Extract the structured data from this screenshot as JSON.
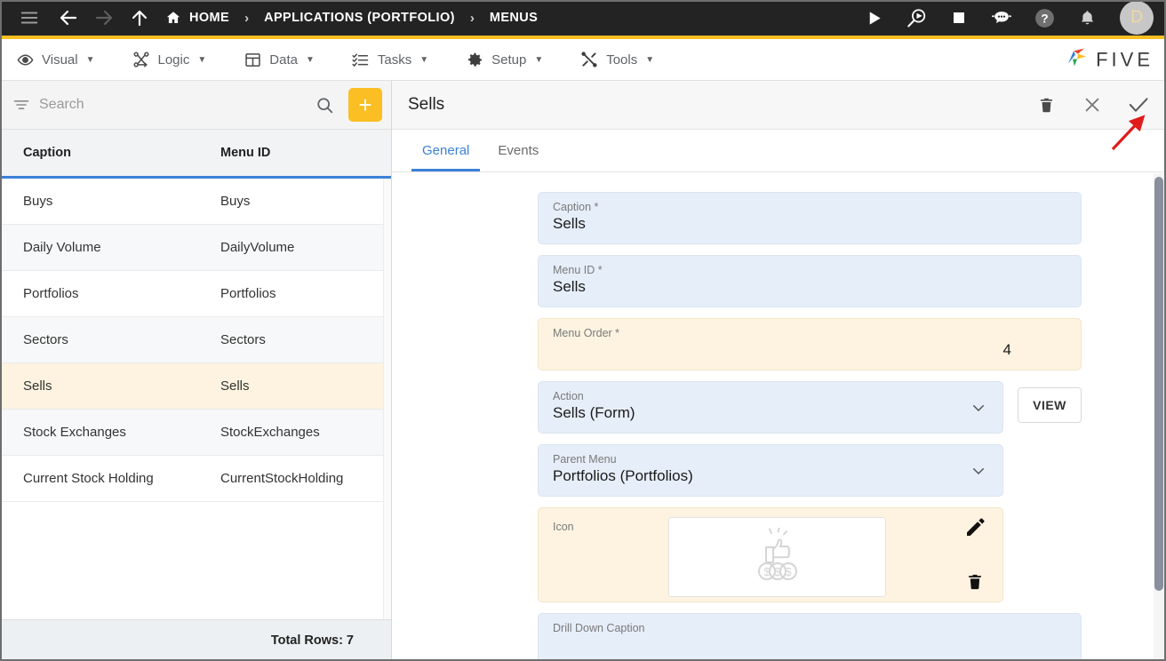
{
  "topbar": {
    "icons": [
      {
        "name": "hamburger-menu-icon",
        "label": "Menu"
      },
      {
        "name": "back-arrow-icon",
        "label": "Back"
      },
      {
        "name": "forward-arrow-icon",
        "label": "Forward"
      },
      {
        "name": "up-arrow-icon",
        "label": "Up"
      }
    ],
    "breadcrumbs": [
      {
        "label": "HOME",
        "icon": "home-icon"
      },
      {
        "label": "APPLICATIONS (PORTFOLIO)",
        "icon": ""
      },
      {
        "label": "MENUS",
        "icon": ""
      }
    ],
    "separator": "›",
    "right_icons": [
      {
        "name": "run-play-icon",
        "label": "Run"
      },
      {
        "name": "debug-magnifier-play-icon",
        "label": "Debug"
      },
      {
        "name": "stop-square-icon",
        "label": "Stop"
      },
      {
        "name": "assistant-robot-icon",
        "label": "Assistant"
      },
      {
        "name": "help-question-icon",
        "label": "Help"
      },
      {
        "name": "notification-bell-icon",
        "label": "Notifications"
      }
    ],
    "avatar_initial": "D",
    "accent_bar_color": "#fbbf24",
    "background_color": "#232323"
  },
  "menubar": {
    "items": [
      {
        "label": "Visual",
        "icon": "eye-icon",
        "caret": "▼"
      },
      {
        "label": "Logic",
        "icon": "logic-nodes-icon",
        "caret": "▼"
      },
      {
        "label": "Data",
        "icon": "data-grid-icon",
        "caret": "▼"
      },
      {
        "label": "Tasks",
        "icon": "tasks-checklist-icon",
        "caret": "▼"
      },
      {
        "label": "Setup",
        "icon": "gear-icon",
        "caret": "▼"
      },
      {
        "label": "Tools",
        "icon": "tools-wrench-icon",
        "caret": "▼"
      }
    ],
    "brand": "FIVE"
  },
  "sidebar": {
    "search": {
      "placeholder": "Search",
      "value": "",
      "filter_icon": "filter-icon",
      "search_icon": "search-icon",
      "add_label": "+"
    },
    "columns": [
      "Caption",
      "Menu ID"
    ],
    "rows": [
      {
        "caption": "Buys",
        "menu_id": "Buys",
        "selected": false
      },
      {
        "caption": "Daily Volume",
        "menu_id": "DailyVolume",
        "selected": false
      },
      {
        "caption": "Portfolios",
        "menu_id": "Portfolios",
        "selected": false
      },
      {
        "caption": "Sectors",
        "menu_id": "Sectors",
        "selected": false
      },
      {
        "caption": "Sells",
        "menu_id": "Sells",
        "selected": true
      },
      {
        "caption": "Stock Exchanges",
        "menu_id": "StockExchanges",
        "selected": false
      },
      {
        "caption": "Current Stock Holding",
        "menu_id": "CurrentStockHolding",
        "selected": false
      }
    ],
    "footer": "Total Rows: 7",
    "selected_row_color": "#fdf3e0",
    "header_underline_color": "#3b82d6"
  },
  "panel": {
    "title": "Sells",
    "actions": [
      {
        "name": "delete-record-button",
        "icon": "trash-icon"
      },
      {
        "name": "close-panel-button",
        "icon": "close-x-icon"
      },
      {
        "name": "save-record-button",
        "icon": "check-icon"
      }
    ],
    "tabs": [
      {
        "label": "General",
        "active": true
      },
      {
        "label": "Events",
        "active": false
      }
    ],
    "fields": [
      {
        "key": "caption",
        "label": "Caption *",
        "value": "Sells",
        "type": "text",
        "style": "blue"
      },
      {
        "key": "menu_id",
        "label": "Menu ID *",
        "value": "Sells",
        "type": "text",
        "style": "blue"
      },
      {
        "key": "menu_order",
        "label": "Menu Order *",
        "value": "4",
        "type": "number",
        "style": "warn"
      },
      {
        "key": "action",
        "label": "Action",
        "value": "Sells (Form)",
        "type": "select",
        "style": "blue",
        "button": "VIEW"
      },
      {
        "key": "parent_menu",
        "label": "Parent Menu",
        "value": "Portfolios (Portfolios)",
        "type": "select",
        "style": "blue"
      },
      {
        "key": "icon",
        "label": "Icon",
        "value": "",
        "type": "image",
        "style": "warn",
        "image_icon": "thumbs-up-dollars-icon"
      },
      {
        "key": "drill_down_caption",
        "label": "Drill Down Caption",
        "value": "",
        "type": "text",
        "style": "blue"
      }
    ],
    "icon_field_actions": [
      {
        "name": "edit-icon-button",
        "icon": "pencil-icon"
      },
      {
        "name": "delete-icon-button",
        "icon": "trash-icon"
      }
    ],
    "chevron": "⌄",
    "active_tab_color": "#3b82d6"
  },
  "annotation": {
    "arrow_color": "#e01b1b",
    "points_to": "save-record-button"
  }
}
